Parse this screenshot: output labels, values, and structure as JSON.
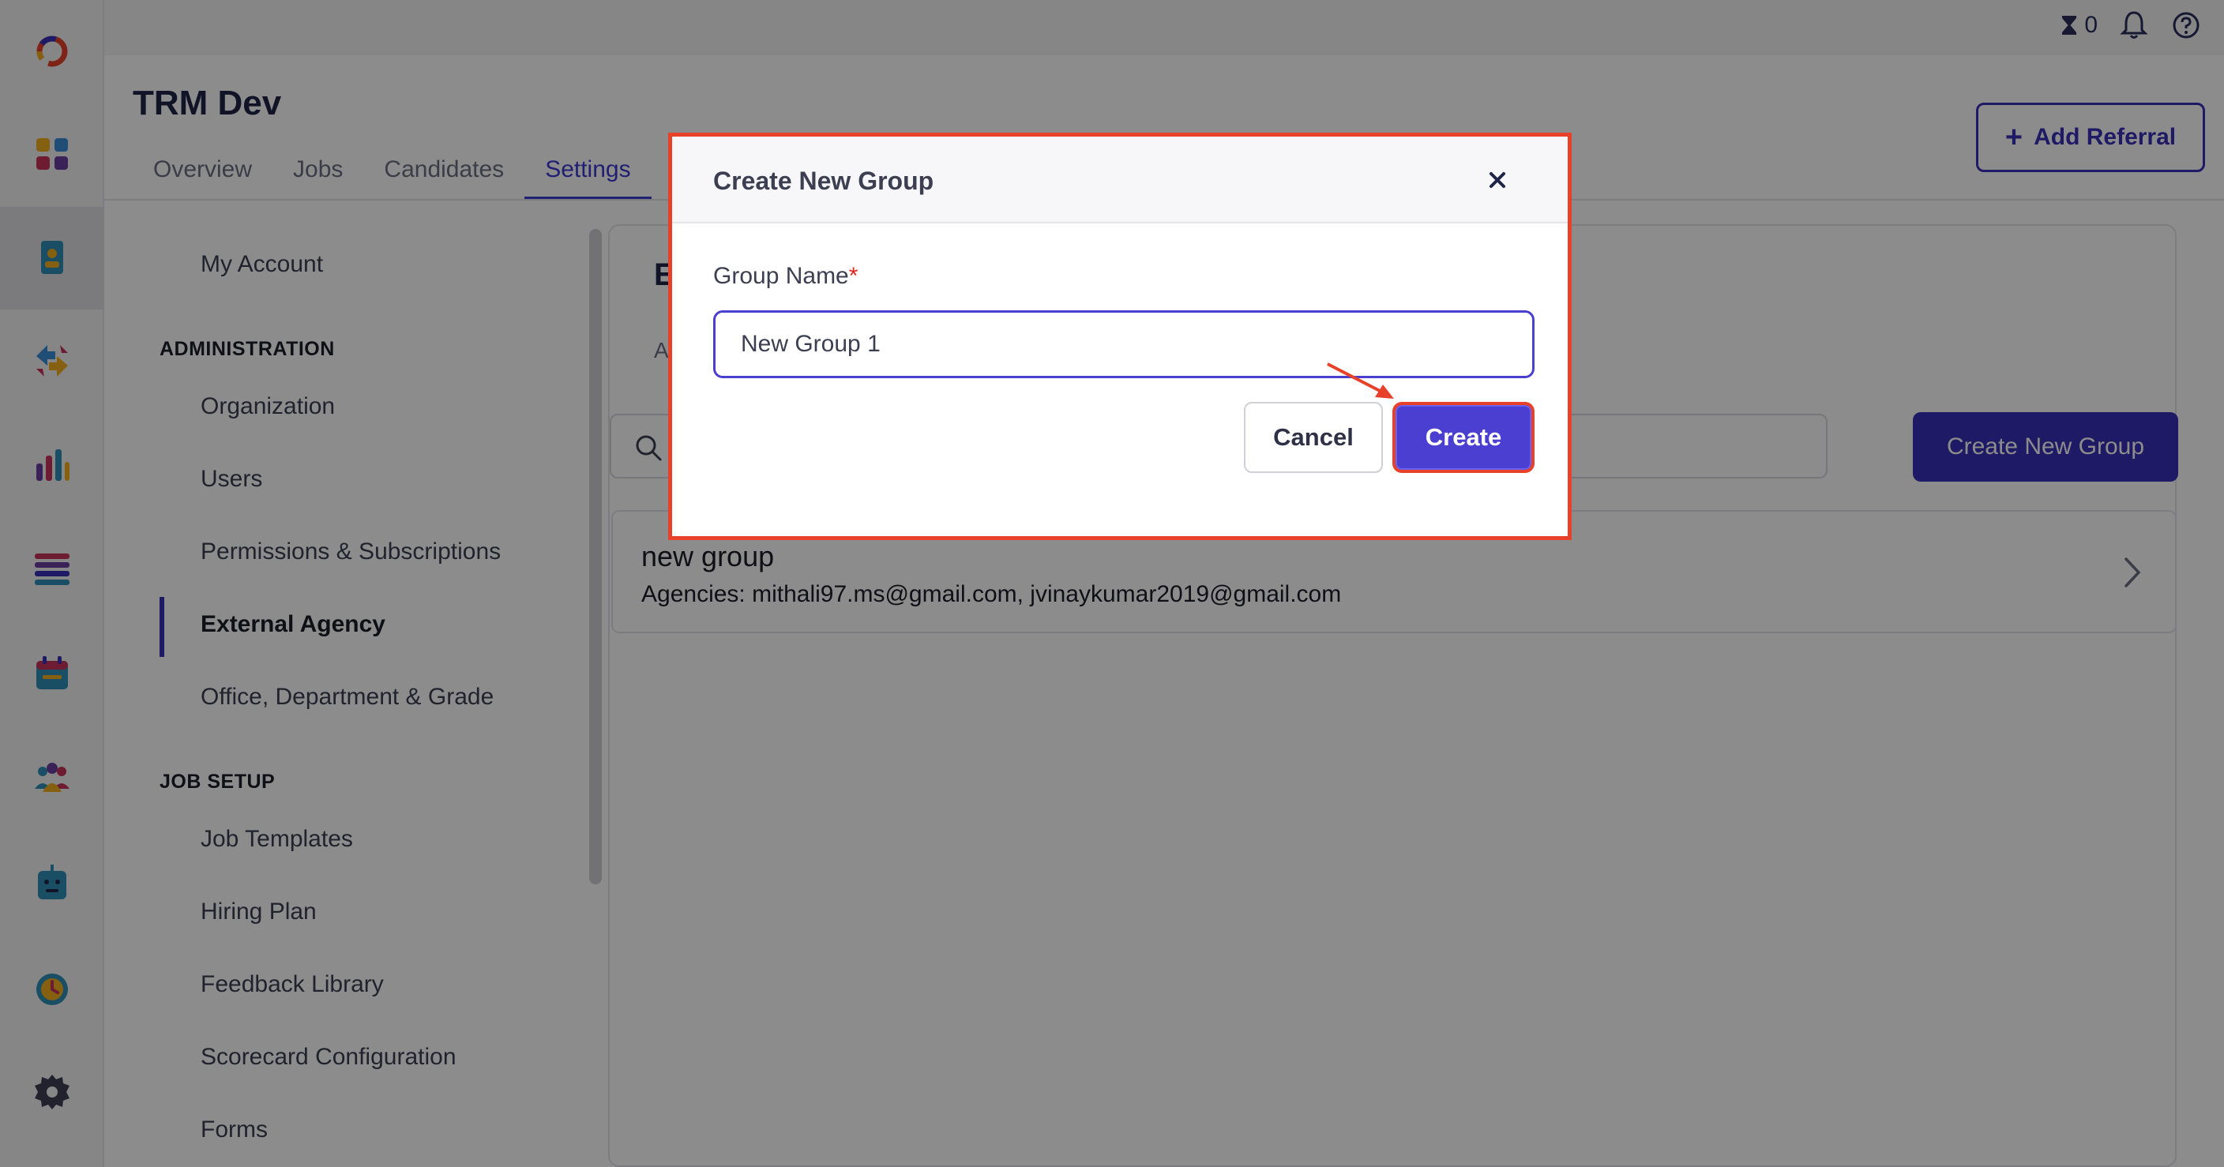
{
  "app": {
    "title": "TRM Dev",
    "tabs": [
      {
        "label": "Overview"
      },
      {
        "label": "Jobs"
      },
      {
        "label": "Candidates"
      },
      {
        "label": "Settings"
      }
    ],
    "add_referral_label": "Add Referral",
    "timer_count": "0"
  },
  "rail": {
    "icons": [
      "logo-icon",
      "dashboard-icon",
      "referrals-icon",
      "transfer-icon",
      "analytics-icon",
      "list-icon",
      "calendar-icon",
      "team-icon",
      "bot-icon",
      "clock-icon",
      "settings-icon"
    ]
  },
  "settings_nav": {
    "my_account": "My Account",
    "admin_section": "ADMINISTRATION",
    "admin_items": [
      "Organization",
      "Users",
      "Permissions & Subscriptions",
      "External Agency",
      "Office, Department & Grade"
    ],
    "job_section": "JOB SETUP",
    "job_items": [
      "Job Templates",
      "Hiring Plan",
      "Feedback Library",
      "Scorecard Configuration",
      "Forms"
    ],
    "active_item": "External Agency"
  },
  "content": {
    "title_fragment": "E",
    "subtitle_fragment": "A",
    "create_group_label": "Create New Group",
    "groups": [
      {
        "name": "new group",
        "agencies": "Agencies: mithali97.ms@gmail.com, jvinaykumar2019@gmail.com"
      }
    ]
  },
  "modal": {
    "title": "Create New Group",
    "field_label": "Group Name",
    "required_mark": "*",
    "input_value": "New Group 1",
    "cancel_label": "Cancel",
    "create_label": "Create"
  },
  "colors": {
    "accent": "#3a31b8",
    "primary_button": "#4a3fd0",
    "highlight_border": "#e8412a"
  }
}
